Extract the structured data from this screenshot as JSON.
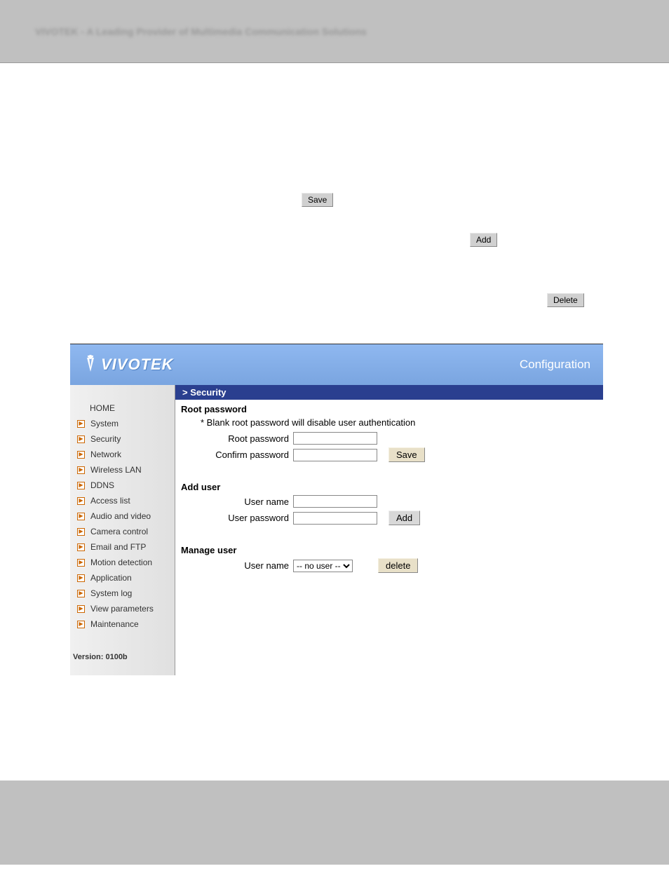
{
  "top_banner": "VIVOTEK - A Leading Provider of Multimedia Communication Solutions",
  "floating": {
    "save": "Save",
    "add": "Add",
    "delete": "Delete"
  },
  "header": {
    "logo_text": "VIVOTEK",
    "config_label": "Configuration"
  },
  "sidebar": {
    "home": "HOME",
    "items": [
      "System",
      "Security",
      "Network",
      "Wireless LAN",
      "DDNS",
      "Access list",
      "Audio and video",
      "Camera control",
      "Email and FTP",
      "Motion detection",
      "Application",
      "System log",
      "View parameters",
      "Maintenance"
    ],
    "version": "Version: 0100b"
  },
  "main": {
    "title": "> Security",
    "root_password": {
      "heading": "Root password",
      "note": "* Blank root password will disable user authentication",
      "root_label": "Root password",
      "confirm_label": "Confirm password",
      "save": "Save"
    },
    "add_user": {
      "heading": "Add user",
      "username_label": "User name",
      "password_label": "User password",
      "add": "Add"
    },
    "manage_user": {
      "heading": "Manage user",
      "username_label": "User name",
      "no_user_option": "-- no user --",
      "delete": "delete"
    }
  }
}
